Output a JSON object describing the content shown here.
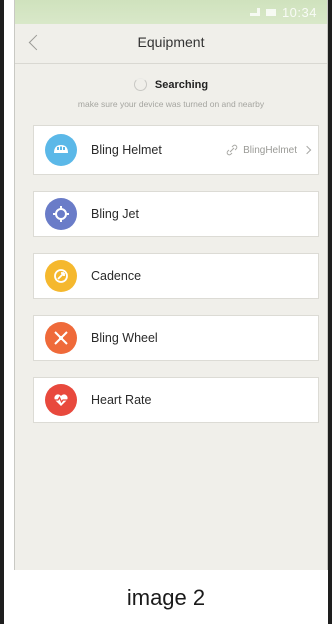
{
  "status_bar": {
    "time": "10:34"
  },
  "header": {
    "title": "Equipment"
  },
  "search": {
    "label": "Searching",
    "hint": "make sure your device was turned on and nearby"
  },
  "devices": [
    {
      "label": "Bling Helmet",
      "color": "#5bb8e8",
      "icon": "helmet-icon",
      "connected_name": "BlingHelmet"
    },
    {
      "label": "Bling Jet",
      "color": "#6a7cc8",
      "icon": "jet-icon"
    },
    {
      "label": "Cadence",
      "color": "#f5b82e",
      "icon": "cadence-icon"
    },
    {
      "label": "Bling Wheel",
      "color": "#ef6a3a",
      "icon": "wheel-icon"
    },
    {
      "label": "Heart Rate",
      "color": "#e8493d",
      "icon": "heart-rate-icon"
    }
  ],
  "caption": "image 2"
}
